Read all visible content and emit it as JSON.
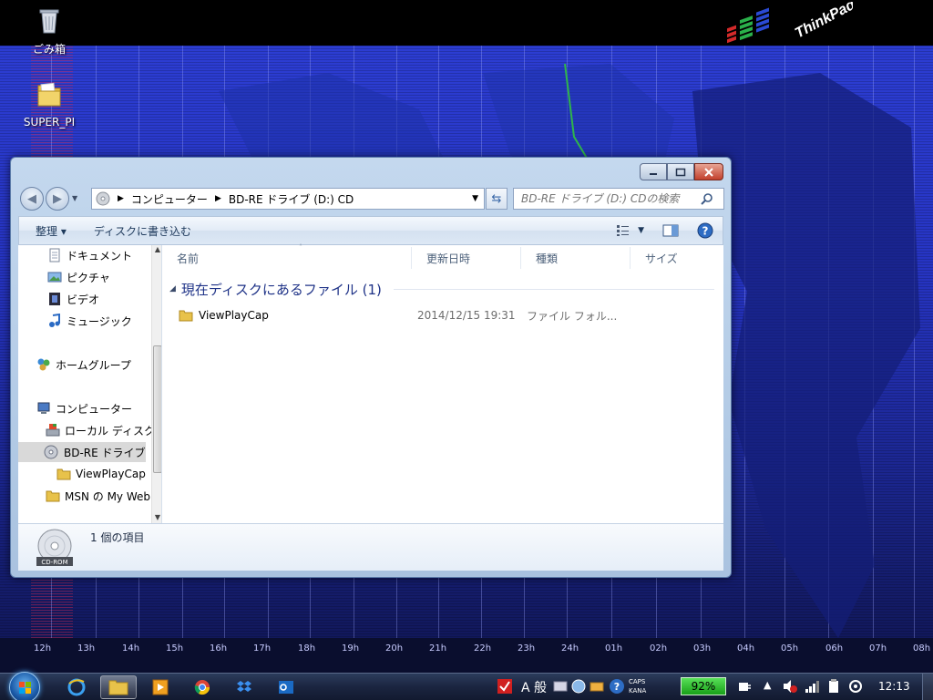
{
  "desktop": {
    "icons": [
      {
        "label": "ごみ箱"
      },
      {
        "label": "SUPER_PI"
      }
    ],
    "brand": "ThinkPad",
    "timeline_hours": [
      "12h",
      "13h",
      "14h",
      "15h",
      "16h",
      "17h",
      "18h",
      "19h",
      "20h",
      "21h",
      "22h",
      "23h",
      "24h",
      "01h",
      "02h",
      "03h",
      "04h",
      "05h",
      "06h",
      "07h",
      "08h"
    ]
  },
  "window": {
    "breadcrumbs": [
      "コンピューター",
      "BD-RE ドライブ (D:) CD"
    ],
    "search_placeholder": "BD-RE ドライブ (D:) CDの検索",
    "toolbar": {
      "organize_label": "整理 ▾",
      "burn_label": "ディスクに書き込む"
    },
    "nav_items": [
      {
        "label": "ドキュメント"
      },
      {
        "label": "ピクチャ"
      },
      {
        "label": "ビデオ"
      },
      {
        "label": "ミュージック"
      },
      {
        "label": "ホームグループ"
      },
      {
        "label": "コンピューター"
      },
      {
        "label": "ローカル ディスク"
      },
      {
        "label": "BD-RE ドライブ"
      },
      {
        "label": "ViewPlayCap"
      },
      {
        "label": "MSN の My Web"
      }
    ],
    "columns": {
      "name": "名前",
      "date": "更新日時",
      "type": "種類",
      "size": "サイズ"
    },
    "group_header": "現在ディスクにあるファイル (1)",
    "files": [
      {
        "name": "ViewPlayCap",
        "date": "2014/12/15 19:31",
        "type": "ファイル フォル..."
      }
    ],
    "details": {
      "item_count": "1 個の項目",
      "drive_icon_label": "CD-ROM"
    }
  },
  "taskbar": {
    "battery_percent": "92%",
    "caps_label": "CAPS",
    "kana_label": "KANA",
    "ime_label": "A 般",
    "clock": "12:13"
  }
}
